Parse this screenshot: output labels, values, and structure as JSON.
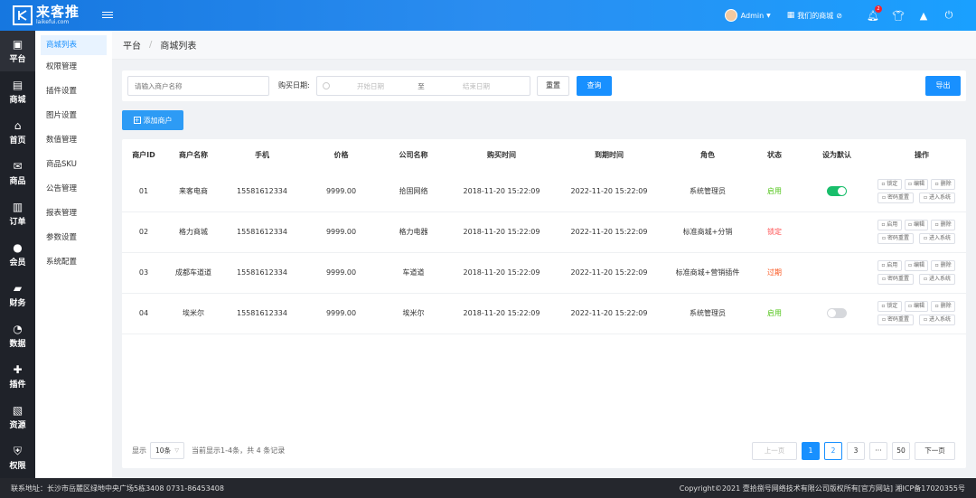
{
  "brand": {
    "name": "来客推",
    "domain": "laikefui.com"
  },
  "topbar": {
    "admin_name": "Admin",
    "shop_link": "我们的商城",
    "notification_count": "2"
  },
  "iconbar": [
    {
      "label": "平台",
      "icon": "platform-icon"
    },
    {
      "label": "商城",
      "icon": "mall-icon"
    },
    {
      "label": "首页",
      "icon": "home-icon"
    },
    {
      "label": "商品",
      "icon": "goods-icon"
    },
    {
      "label": "订单",
      "icon": "order-icon"
    },
    {
      "label": "会员",
      "icon": "member-icon"
    },
    {
      "label": "财务",
      "icon": "finance-icon"
    },
    {
      "label": "数据",
      "icon": "data-icon"
    },
    {
      "label": "插件",
      "icon": "plugin-icon"
    },
    {
      "label": "资源",
      "icon": "resource-icon"
    },
    {
      "label": "权限",
      "icon": "permission-icon"
    }
  ],
  "subnav": [
    "商城列表",
    "权限管理",
    "插件设置",
    "图片设置",
    "数值管理",
    "商品SKU",
    "公告管理",
    "报表管理",
    "参数设置",
    "系统配置"
  ],
  "breadcrumb": {
    "root": "平台",
    "current": "商城列表"
  },
  "filter": {
    "merchant_placeholder": "请输入商户名称",
    "date_label": "购买日期:",
    "start_placeholder": "开始日期",
    "to": "至",
    "end_placeholder": "结束日期",
    "reset": "重置",
    "search": "查询",
    "export": "导出"
  },
  "add_button": "添加商户",
  "table": {
    "headers": [
      "商户ID",
      "商户名称",
      "手机",
      "价格",
      "公司名称",
      "购买时间",
      "到期时间",
      "角色",
      "状态",
      "设为默认",
      "操作"
    ],
    "rows": [
      {
        "id": "01",
        "name": "来客电商",
        "phone": "15581612334",
        "price": "9999.00",
        "company": "拾固网络",
        "buy": "2018-11-20 15:22:09",
        "expire": "2022-11-20 15:22:09",
        "role": "系统管理员",
        "status": "启用",
        "status_kind": "enabled",
        "default_on": true,
        "op1": "锁定"
      },
      {
        "id": "02",
        "name": "格力商城",
        "phone": "15581612334",
        "price": "9999.00",
        "company": "格力电器",
        "buy": "2018-11-20 15:22:09",
        "expire": "2022-11-20 15:22:09",
        "role": "标准商城+分销",
        "status": "锁定",
        "status_kind": "locked",
        "default_on": null,
        "op1": "启用"
      },
      {
        "id": "03",
        "name": "成都车道道",
        "phone": "15581612334",
        "price": "9999.00",
        "company": "车道道",
        "buy": "2018-11-20 15:22:09",
        "expire": "2022-11-20 15:22:09",
        "role": "标准商城+营销插件",
        "status": "过期",
        "status_kind": "expired",
        "default_on": null,
        "op1": "启用"
      },
      {
        "id": "04",
        "name": "埃米尔",
        "phone": "15581612334",
        "price": "9999.00",
        "company": "埃米尔",
        "buy": "2018-11-20 15:22:09",
        "expire": "2022-11-20 15:22:09",
        "role": "系统管理员",
        "status": "启用",
        "status_kind": "enabled",
        "default_on": false,
        "op1": "锁定"
      }
    ],
    "ops": {
      "edit": "编辑",
      "delete": "删除",
      "reset_pwd": "密码重置",
      "enter": "进入系统"
    }
  },
  "pager": {
    "show_label": "显示",
    "page_size": "10条",
    "summary": "当前显示1-4条，共 4 条记录",
    "prev": "上一页",
    "pages": [
      "1",
      "2",
      "3",
      "···",
      "50"
    ],
    "next": "下一页"
  },
  "footer": {
    "address": "联系地址：长沙市岳麓区绿地中央广场5栋3408   0731-86453408",
    "copyright": "Copyright©2021 壹拾捌号网络技术有限公司版权所有[官方网站]   湘ICP备17020355号"
  },
  "colors": {
    "topbar": "#1a8cff",
    "primary": "#1890ff",
    "sidebar": "#1f2229",
    "enabled": "#52c41a",
    "locked": "#ff4d4f"
  }
}
